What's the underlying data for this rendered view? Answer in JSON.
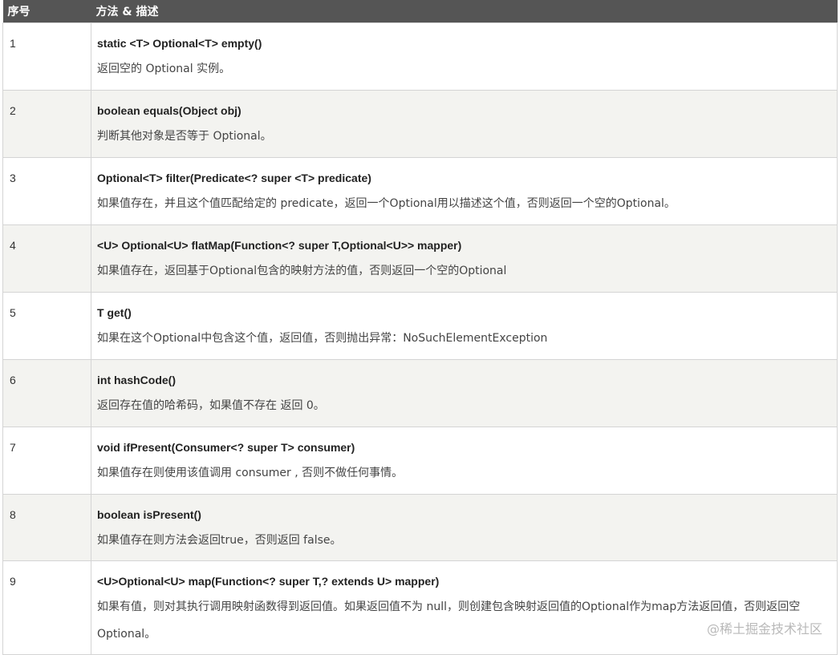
{
  "header": {
    "col_num": "序号",
    "col_desc": "方法 & 描述"
  },
  "rows": [
    {
      "num": "1",
      "sig": "static <T> Optional<T> empty()",
      "desc": "返回空的 Optional 实例。"
    },
    {
      "num": "2",
      "sig": "boolean equals(Object obj)",
      "desc": "判断其他对象是否等于 Optional。"
    },
    {
      "num": "3",
      "sig": "Optional<T> filter(Predicate<? super <T> predicate)",
      "desc": "如果值存在，并且这个值匹配给定的 predicate，返回一个Optional用以描述这个值，否则返回一个空的Optional。"
    },
    {
      "num": "4",
      "sig": "<U> Optional<U> flatMap(Function<? super T,Optional<U>> mapper)",
      "desc": "如果值存在，返回基于Optional包含的映射方法的值，否则返回一个空的Optional"
    },
    {
      "num": "5",
      "sig": "T get()",
      "desc": "如果在这个Optional中包含这个值，返回值，否则抛出异常：NoSuchElementException"
    },
    {
      "num": "6",
      "sig": "int hashCode()",
      "desc": "返回存在值的哈希码，如果值不存在 返回 0。"
    },
    {
      "num": "7",
      "sig": "void ifPresent(Consumer<? super T> consumer)",
      "desc": "如果值存在则使用该值调用 consumer , 否则不做任何事情。"
    },
    {
      "num": "8",
      "sig": "boolean isPresent()",
      "desc": "如果值存在则方法会返回true，否则返回 false。"
    },
    {
      "num": "9",
      "sig": "<U>Optional<U> map(Function<? super T,? extends U> mapper)",
      "desc": "如果有值，则对其执行调用映射函数得到返回值。如果返回值不为 null，则创建包含映射返回值的Optional作为map方法返回值，否则返回空Optional。"
    }
  ],
  "watermark": "@稀土掘金技术社区"
}
